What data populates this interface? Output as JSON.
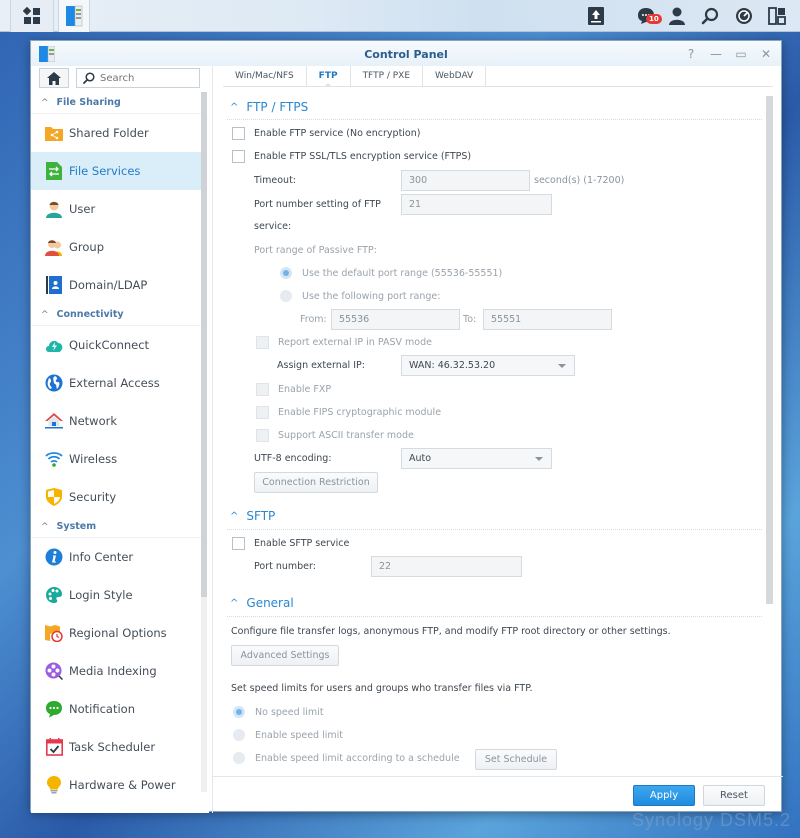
{
  "taskbar": {
    "notification_count": "10"
  },
  "window": {
    "title": "Control Panel",
    "controls": {
      "help": "?",
      "minimize": "—",
      "maximize": "▭",
      "close": "✕"
    }
  },
  "sidebar": {
    "search_placeholder": "Search",
    "sections": [
      {
        "label": "File Sharing",
        "items": [
          {
            "label": "Shared Folder",
            "icon": "shared-folder-icon",
            "color": "#f5a623"
          },
          {
            "label": "File Services",
            "icon": "file-services-icon",
            "color": "#3db33d",
            "active": true
          },
          {
            "label": "User",
            "icon": "user-icon",
            "color": "#26a69a"
          },
          {
            "label": "Group",
            "icon": "group-icon",
            "color": "#e05040"
          },
          {
            "label": "Domain/LDAP",
            "icon": "domain-ldap-icon",
            "color": "#1e6fd0"
          }
        ]
      },
      {
        "label": "Connectivity",
        "items": [
          {
            "label": "QuickConnect",
            "icon": "quickconnect-icon",
            "color": "#1fb5a8"
          },
          {
            "label": "External Access",
            "icon": "globe-icon",
            "color": "#1e73d2"
          },
          {
            "label": "Network",
            "icon": "network-icon",
            "color": "#e04848"
          },
          {
            "label": "Wireless",
            "icon": "wifi-icon",
            "color": "#1e88e5"
          },
          {
            "label": "Security",
            "icon": "shield-icon",
            "color": "#f5b400"
          }
        ]
      },
      {
        "label": "System",
        "items": [
          {
            "label": "Info Center",
            "icon": "info-icon",
            "color": "#1e7fd8"
          },
          {
            "label": "Login Style",
            "icon": "palette-icon",
            "color": "#19a99d"
          },
          {
            "label": "Regional Options",
            "icon": "regional-options-icon",
            "color": "#f5a623"
          },
          {
            "label": "Media Indexing",
            "icon": "media-indexing-icon",
            "color": "#9c5ce0"
          },
          {
            "label": "Notification",
            "icon": "notification-icon",
            "color": "#2eaa2e"
          },
          {
            "label": "Task Scheduler",
            "icon": "task-scheduler-icon",
            "color": "#e53950"
          },
          {
            "label": "Hardware & Power",
            "icon": "lightbulb-icon",
            "color": "#f5b400"
          }
        ]
      }
    ]
  },
  "tabs": [
    {
      "label": "Win/Mac/NFS"
    },
    {
      "label": "FTP",
      "active": true
    },
    {
      "label": "TFTP / PXE"
    },
    {
      "label": "WebDAV"
    }
  ],
  "ftp": {
    "section_title": "FTP / FTPS",
    "enable_ftp": "Enable FTP service (No encryption)",
    "enable_ftps": "Enable FTP SSL/TLS encryption service (FTPS)",
    "timeout_label": "Timeout:",
    "timeout_value": "300",
    "timeout_unit": "second(s) (1-7200)",
    "port_label_1": "Port number setting of FTP",
    "port_label_2": "service:",
    "port_value": "21",
    "passive_label": "Port range of Passive FTP:",
    "passive_default": "Use the default port range (55536-55551)",
    "passive_custom": "Use the following port range:",
    "from_label": "From:",
    "from_value": "55536",
    "to_label": "To:",
    "to_value": "55551",
    "report_ip": "Report external IP in PASV mode",
    "assign_ip_label": "Assign external IP:",
    "assign_ip_value": "WAN: 46.32.53.20",
    "enable_fxp": "Enable FXP",
    "enable_fips": "Enable FIPS cryptographic module",
    "ascii_mode": "Support ASCII transfer mode",
    "utf8_label": "UTF-8 encoding:",
    "utf8_value": "Auto",
    "connection_restriction": "Connection Restriction"
  },
  "sftp": {
    "section_title": "SFTP",
    "enable_sftp": "Enable SFTP service",
    "port_label": "Port number:",
    "port_value": "22"
  },
  "general": {
    "section_title": "General",
    "description": "Configure file transfer logs, anonymous FTP, and modify FTP root directory or other settings.",
    "advanced_settings": "Advanced Settings",
    "speed_description": "Set speed limits for users and groups who transfer files via FTP.",
    "no_speed_limit": "No speed limit",
    "enable_speed_limit": "Enable speed limit",
    "speed_schedule": "Enable speed limit according to a schedule",
    "set_schedule": "Set Schedule"
  },
  "footer": {
    "apply": "Apply",
    "reset": "Reset"
  },
  "watermark": "Synology DSM5.2"
}
